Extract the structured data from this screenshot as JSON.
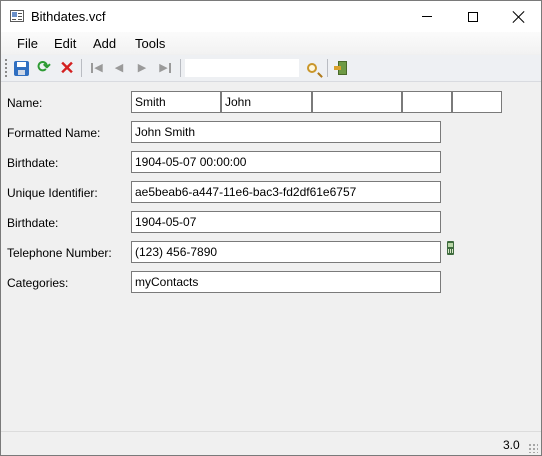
{
  "window": {
    "title": "Bithdates.vcf"
  },
  "menu": {
    "items": [
      "File",
      "Edit",
      "Add",
      "Tools"
    ]
  },
  "toolbar": {
    "search_value": "",
    "icons": [
      "save-icon",
      "refresh-icon",
      "delete-icon",
      "first-record-icon",
      "previous-record-icon",
      "next-record-icon",
      "last-record-icon",
      "search-icon",
      "exit-icon"
    ]
  },
  "form": {
    "name": {
      "label": "Name:",
      "family": "Smith",
      "given": "John",
      "additional": "",
      "prefix": "",
      "suffix": ""
    },
    "formatted_name": {
      "label": "Formatted Name:",
      "value": "John Smith"
    },
    "birthdate1": {
      "label": "Birthdate:",
      "value": "1904-05-07 00:00:00"
    },
    "uid": {
      "label": "Unique Identifier:",
      "value": "ae5beab6-a447-11e6-bac3-fd2df61e6757"
    },
    "birthdate2": {
      "label": "Birthdate:",
      "value": "1904-05-07"
    },
    "telephone": {
      "label": "Telephone Number:",
      "value": "(123) 456-7890"
    },
    "categories": {
      "label": "Categories:",
      "value": "myContacts"
    }
  },
  "status": {
    "version": "3.0"
  }
}
